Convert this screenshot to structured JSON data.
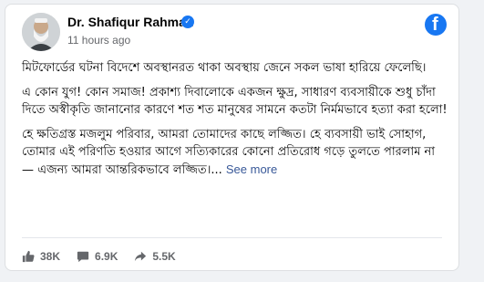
{
  "post": {
    "author": "Dr. Shafiqur Rahman",
    "time": "11 hours ago",
    "paragraphs": [
      "মিটফোর্ডের ঘটনা বিদেশে অবস্থানরত থাকা অবস্থায় জেনে সকল ভাষা হারিয়ে ফেলেছি।",
      "এ কোন যুগ! কোন সমাজ! প্রকাশ্য দিবালোকে একজন ক্ষুদ্র, সাধারণ ব্যবসায়ীকে শুধু চাঁদা দিতে অস্বীকৃতি জানানোর কারণে শত শত মানুষের সামনে কতটা নির্মমভাবে হত্যা করা হলো!",
      "হে ক্ষতিগ্রস্ত মজলুম পরিবার, আমরা তোমাদের কাছে লজ্জিত। হে ব্যবসায়ী ভাই সোহাগ, তোমার এই পরিণতি হওয়ার আগে সত্যিকারের কোনো প্রতিরোধ গড়ে তুলতে পারলাম না — এজন্য আমরা আন্তরিকভাবে লজ্জিত।..."
    ],
    "see_more": "See more"
  },
  "stats": {
    "likes": "38K",
    "comments": "6.9K",
    "shares": "5.5K"
  },
  "icons": {
    "brand": "facebook-logo-icon",
    "badge": "verified-badge-icon",
    "like": "thumbs-up-icon",
    "comment": "comment-icon",
    "share": "share-icon"
  },
  "colors": {
    "brand": "#1877f2",
    "link": "#385898",
    "muted": "#65676b"
  }
}
